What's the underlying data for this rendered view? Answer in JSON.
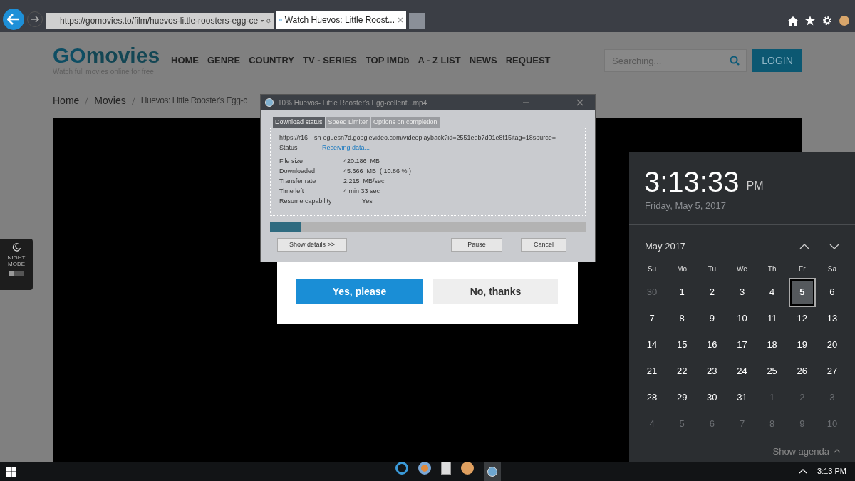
{
  "browser": {
    "address": "https://gomovies.to/film/huevos-little-roosters-egg-ce",
    "tab_title": "Watch Huevos: Little Roost..."
  },
  "site": {
    "logo_word_1": "GO",
    "logo_word_2": "movies",
    "tagline": "Watch full movies online for free",
    "nav": [
      "HOME",
      "GENRE",
      "COUNTRY",
      "TV - SERIES",
      "TOP IMDb",
      "A - Z LIST",
      "NEWS",
      "REQUEST"
    ],
    "search": {
      "placeholder": "Searching..."
    },
    "login": "LOGIN",
    "breadcrumb": [
      "Home",
      "Movies",
      "Huevos: Little Rooster's Egg-c"
    ],
    "night_mode": {
      "label": "NIGHT MODE",
      "on": false
    },
    "prompt_buttons": [
      "Yes, please",
      "No, thanks"
    ]
  },
  "download_dialog": {
    "title": "10% Huevos- Little Rooster's Egg-cellent...mp4",
    "tabs": [
      {
        "label": "Download status",
        "selected": true
      },
      {
        "label": "Speed Limiter",
        "selected": false
      },
      {
        "label": "Options on completion",
        "selected": false
      }
    ],
    "url": "https://r16---sn-oguesn7d.googlevideo.com/videoplayback?id=2551eeb7d01e8f15itag=18source=",
    "status_label": "Status",
    "status_value": "Receiving data...",
    "fields": [
      {
        "label": "File size",
        "value": "420.186  MB"
      },
      {
        "label": "Downloaded",
        "value": "45.666  MB  ( 10.86 % )"
      },
      {
        "label": "Transfer rate",
        "value": "2.215  MB/sec"
      },
      {
        "label": "Time left",
        "value": "4 min 33 sec"
      },
      {
        "label": "Resume capability",
        "value": "Yes",
        "indent": true
      }
    ],
    "level": 0.1,
    "buttons": [
      "Show details >>",
      "Pause",
      "Cancel"
    ]
  },
  "clock": {
    "time": "3:13:33",
    "ampm": "PM",
    "date": "Friday, May 5, 2017",
    "month": "May 2017",
    "weekdays": [
      "Su",
      "Mo",
      "Tu",
      "We",
      "Th",
      "Fr",
      "Sa"
    ],
    "days": [
      {
        "label": "30",
        "in_month": false,
        "selected": false
      },
      {
        "label": "1",
        "in_month": true,
        "selected": false
      },
      {
        "label": "2",
        "in_month": true,
        "selected": false
      },
      {
        "label": "3",
        "in_month": true,
        "selected": false
      },
      {
        "label": "4",
        "in_month": true,
        "selected": false
      },
      {
        "label": "5",
        "in_month": true,
        "selected": true
      },
      {
        "label": "6",
        "in_month": true,
        "selected": false
      },
      {
        "label": "7",
        "in_month": true,
        "selected": false
      },
      {
        "label": "8",
        "in_month": true,
        "selected": false
      },
      {
        "label": "9",
        "in_month": true,
        "selected": false
      },
      {
        "label": "10",
        "in_month": true,
        "selected": false
      },
      {
        "label": "11",
        "in_month": true,
        "selected": false
      },
      {
        "label": "12",
        "in_month": true,
        "selected": false
      },
      {
        "label": "13",
        "in_month": true,
        "selected": false
      },
      {
        "label": "14",
        "in_month": true,
        "selected": false
      },
      {
        "label": "15",
        "in_month": true,
        "selected": false
      },
      {
        "label": "16",
        "in_month": true,
        "selected": false
      },
      {
        "label": "17",
        "in_month": true,
        "selected": false
      },
      {
        "label": "18",
        "in_month": true,
        "selected": false
      },
      {
        "label": "19",
        "in_month": true,
        "selected": false
      },
      {
        "label": "20",
        "in_month": true,
        "selected": false
      },
      {
        "label": "21",
        "in_month": true,
        "selected": false
      },
      {
        "label": "22",
        "in_month": true,
        "selected": false
      },
      {
        "label": "23",
        "in_month": true,
        "selected": false
      },
      {
        "label": "24",
        "in_month": true,
        "selected": false
      },
      {
        "label": "25",
        "in_month": true,
        "selected": false
      },
      {
        "label": "26",
        "in_month": true,
        "selected": false
      },
      {
        "label": "27",
        "in_month": true,
        "selected": false
      },
      {
        "label": "28",
        "in_month": true,
        "selected": false
      },
      {
        "label": "29",
        "in_month": true,
        "selected": false
      },
      {
        "label": "30",
        "in_month": true,
        "selected": false
      },
      {
        "label": "31",
        "in_month": true,
        "selected": false
      },
      {
        "label": "1",
        "in_month": false,
        "selected": false
      },
      {
        "label": "2",
        "in_month": false,
        "selected": false
      },
      {
        "label": "3",
        "in_month": false,
        "selected": false
      },
      {
        "label": "4",
        "in_month": false,
        "selected": false
      },
      {
        "label": "5",
        "in_month": false,
        "selected": false
      },
      {
        "label": "6",
        "in_month": false,
        "selected": false
      },
      {
        "label": "7",
        "in_month": false,
        "selected": false
      },
      {
        "label": "8",
        "in_month": false,
        "selected": false
      },
      {
        "label": "9",
        "in_month": false,
        "selected": false
      },
      {
        "label": "10",
        "in_month": false,
        "selected": false
      }
    ],
    "show_agenda": "Show agenda"
  },
  "taskbar": {
    "time": "3:13 PM"
  }
}
